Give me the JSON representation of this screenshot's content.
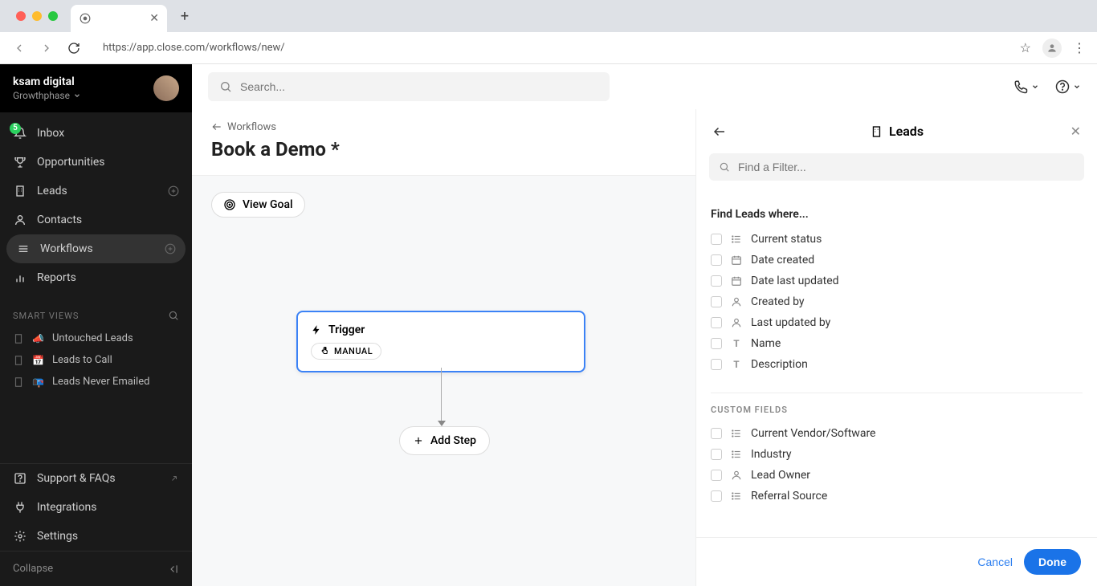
{
  "browser": {
    "url": "https://app.close.com/workflows/new/"
  },
  "org": {
    "name": "ksam digital",
    "subgroup": "Growthphase"
  },
  "sidebar": {
    "items": [
      {
        "label": "Inbox",
        "badge": "5"
      },
      {
        "label": "Opportunities"
      },
      {
        "label": "Leads"
      },
      {
        "label": "Contacts"
      },
      {
        "label": "Workflows"
      },
      {
        "label": "Reports"
      }
    ],
    "smart_views_label": "SMART VIEWS",
    "smart_views": [
      {
        "emoji": "📣",
        "label": "Untouched Leads"
      },
      {
        "emoji": "📅",
        "label": "Leads to Call"
      },
      {
        "emoji": "📭",
        "label": "Leads Never Emailed"
      }
    ],
    "bottom": [
      {
        "label": "Support & FAQs"
      },
      {
        "label": "Integrations"
      },
      {
        "label": "Settings"
      }
    ],
    "collapse_label": "Collapse"
  },
  "topbar": {
    "search_placeholder": "Search..."
  },
  "header": {
    "back": "Workflows",
    "title": "Book a Demo *"
  },
  "canvas": {
    "view_goal": "View Goal",
    "trigger_title": "Trigger",
    "trigger_mode": "MANUAL",
    "add_step": "Add Step"
  },
  "panel": {
    "title": "Leads",
    "search_placeholder": "Find a Filter...",
    "find_heading": "Find Leads where...",
    "filters": [
      {
        "type": "list",
        "label": "Current status"
      },
      {
        "type": "date",
        "label": "Date created"
      },
      {
        "type": "date",
        "label": "Date last updated"
      },
      {
        "type": "user",
        "label": "Created by"
      },
      {
        "type": "user",
        "label": "Last updated by"
      },
      {
        "type": "text",
        "label": "Name"
      },
      {
        "type": "text",
        "label": "Description"
      }
    ],
    "custom_label": "CUSTOM FIELDS",
    "custom_filters": [
      {
        "type": "list",
        "label": "Current Vendor/Software"
      },
      {
        "type": "list",
        "label": "Industry"
      },
      {
        "type": "user",
        "label": "Lead Owner"
      },
      {
        "type": "list",
        "label": "Referral Source"
      }
    ],
    "cancel": "Cancel",
    "done": "Done"
  }
}
